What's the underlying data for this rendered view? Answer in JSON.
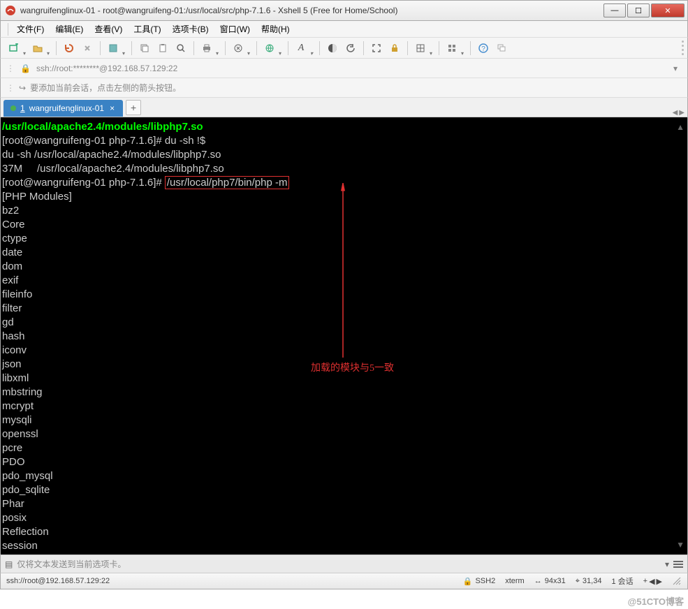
{
  "window": {
    "title": "wangruifenglinux-01 - root@wangruifeng-01:/usr/local/src/php-7.1.6 - Xshell 5 (Free for Home/School)"
  },
  "menu": {
    "items": [
      "文件(F)",
      "编辑(E)",
      "查看(V)",
      "工具(T)",
      "选项卡(B)",
      "窗口(W)",
      "帮助(H)"
    ]
  },
  "addressbar": {
    "text": "ssh://root:********@192.168.57.129:22"
  },
  "infobar": {
    "text": "要添加当前会话，点击左侧的箭头按钮。"
  },
  "tab": {
    "index": "1",
    "label": "wangruifenglinux-01"
  },
  "terminal": {
    "path_line": "/usr/local/apache2.4/modules/libphp7.so",
    "prompt1": "[root@wangruifeng-01 php-7.1.6]# ",
    "cmd1": "du -sh !$",
    "expand": "du -sh /usr/local/apache2.4/modules/libphp7.so",
    "result": "37M     /usr/local/apache2.4/modules/libphp7.so",
    "prompt2": "[root@wangruifeng-01 php-7.1.6]# ",
    "cmd2": "/usr/local/php7/bin/php -m",
    "modules_header": "[PHP Modules]",
    "modules": [
      "bz2",
      "Core",
      "ctype",
      "date",
      "dom",
      "exif",
      "fileinfo",
      "filter",
      "gd",
      "hash",
      "iconv",
      "json",
      "libxml",
      "mbstring",
      "mcrypt",
      "mysqli",
      "openssl",
      "pcre",
      "PDO",
      "pdo_mysql",
      "pdo_sqlite",
      "Phar",
      "posix",
      "Reflection",
      "session"
    ],
    "annotation": "加载的模块与5一致"
  },
  "bottominput": {
    "placeholder": "仅将文本发送到当前选项卡。"
  },
  "status": {
    "conn": "ssh://root@192.168.57.129:22",
    "proto": "SSH2",
    "term": "xterm",
    "size": "94x31",
    "pos": "31,34",
    "sessions": "1 会话"
  },
  "watermark": "@51CTO博客"
}
